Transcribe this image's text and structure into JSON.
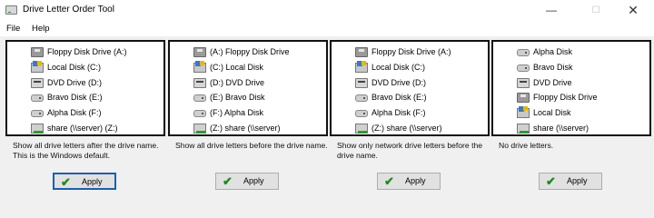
{
  "window": {
    "title": "Drive Letter Order Tool",
    "controls": {
      "minimize": "—",
      "maximize": "☐",
      "close": "✕"
    }
  },
  "menu": {
    "file": "File",
    "help": "Help"
  },
  "panels": [
    {
      "drives": [
        {
          "icon": "floppy-icon",
          "label": "Floppy Disk Drive (A:)"
        },
        {
          "icon": "local-disk-icon",
          "label": "Local Disk (C:)"
        },
        {
          "icon": "dvd-drive-icon",
          "label": "DVD Drive (D:)"
        },
        {
          "icon": "disk-icon",
          "label": "Bravo Disk (E:)"
        },
        {
          "icon": "disk-icon",
          "label": "Alpha Disk (F:)"
        },
        {
          "icon": "network-share-icon",
          "label": "share (\\\\server) (Z:)"
        }
      ],
      "description": "Show all drive letters after the drive name.  This is the Windows default.",
      "apply": "Apply"
    },
    {
      "drives": [
        {
          "icon": "floppy-icon",
          "label": "(A:) Floppy Disk Drive"
        },
        {
          "icon": "local-disk-icon",
          "label": "(C:) Local Disk"
        },
        {
          "icon": "dvd-drive-icon",
          "label": "(D:) DVD Drive"
        },
        {
          "icon": "disk-icon",
          "label": "(E:) Bravo Disk"
        },
        {
          "icon": "disk-icon",
          "label": "(F:) Alpha Disk"
        },
        {
          "icon": "network-share-icon",
          "label": "(Z:) share (\\\\server)"
        }
      ],
      "description": "Show all drive letters before the drive name.",
      "apply": "Apply"
    },
    {
      "drives": [
        {
          "icon": "floppy-icon",
          "label": "Floppy Disk Drive (A:)"
        },
        {
          "icon": "local-disk-icon",
          "label": "Local Disk (C:)"
        },
        {
          "icon": "dvd-drive-icon",
          "label": "DVD Drive (D:)"
        },
        {
          "icon": "disk-icon",
          "label": "Bravo Disk (E:)"
        },
        {
          "icon": "disk-icon",
          "label": "Alpha Disk (F:)"
        },
        {
          "icon": "network-share-icon",
          "label": "(Z:) share (\\\\server)"
        }
      ],
      "description": "Show only network drive letters before the drive name.",
      "apply": "Apply"
    },
    {
      "drives": [
        {
          "icon": "disk-icon",
          "label": "Alpha Disk"
        },
        {
          "icon": "disk-icon",
          "label": "Bravo Disk"
        },
        {
          "icon": "dvd-drive-icon",
          "label": "DVD Drive"
        },
        {
          "icon": "floppy-icon",
          "label": "Floppy Disk Drive"
        },
        {
          "icon": "local-disk-icon",
          "label": "Local Disk"
        },
        {
          "icon": "network-share-icon",
          "label": "share (\\\\server)"
        }
      ],
      "description": "No drive letters.",
      "apply": "Apply"
    }
  ]
}
